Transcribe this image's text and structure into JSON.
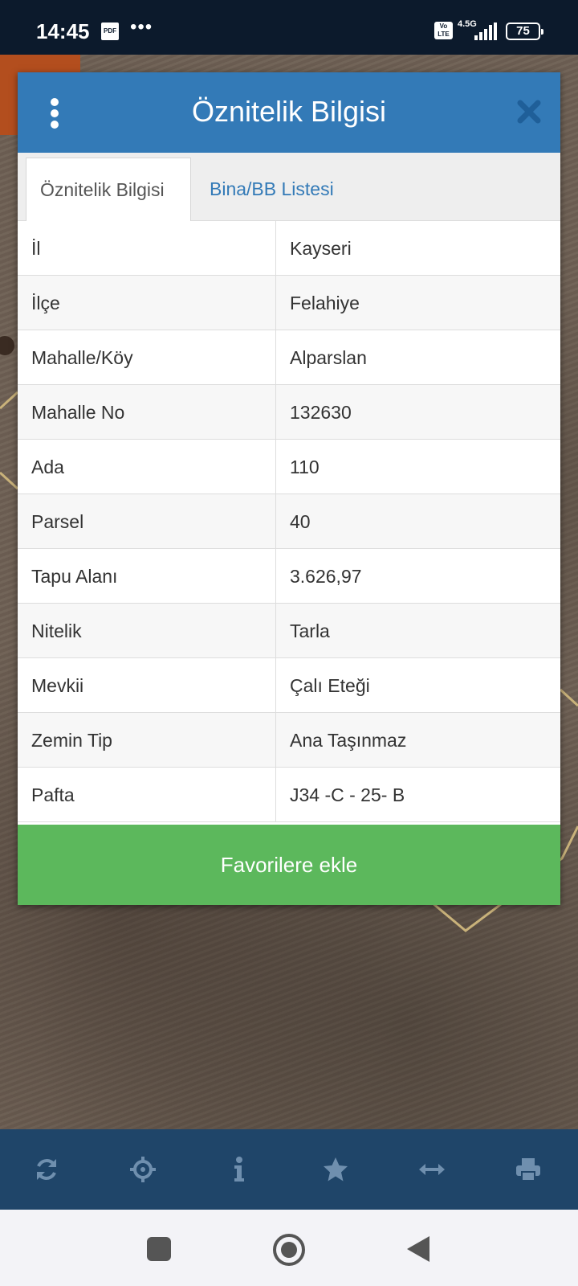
{
  "status_bar": {
    "time": "14:45",
    "pdf_label": "PDF",
    "overflow": "•••",
    "volte": "Vo LTE",
    "network": "4.5G",
    "battery": "75"
  },
  "dialog": {
    "title": "Öznitelik Bilgisi",
    "tabs": [
      {
        "label": "Öznitelik Bilgisi",
        "active": true
      },
      {
        "label": "Bina/BB Listesi",
        "active": false
      }
    ],
    "rows": [
      {
        "label": "İl",
        "value": "Kayseri"
      },
      {
        "label": "İlçe",
        "value": "Felahiye"
      },
      {
        "label": "Mahalle/Köy",
        "value": "Alparslan"
      },
      {
        "label": "Mahalle No",
        "value": "132630"
      },
      {
        "label": "Ada",
        "value": "110"
      },
      {
        "label": "Parsel",
        "value": "40"
      },
      {
        "label": "Tapu Alanı",
        "value": "3.626,97"
      },
      {
        "label": "Nitelik",
        "value": "Tarla"
      },
      {
        "label": "Mevkii",
        "value": "Çalı Eteği"
      },
      {
        "label": "Zemin Tip",
        "value": "Ana Taşınmaz"
      },
      {
        "label": "Pafta",
        "value": "J34 -C - 25- B"
      }
    ],
    "favorite_button": "Favorilere ekle"
  },
  "toolbar": {
    "icons": [
      "refresh-icon",
      "locate-icon",
      "info-icon",
      "star-icon",
      "measure-icon",
      "print-icon"
    ]
  },
  "colors": {
    "header_blue": "#337ab7",
    "button_green": "#5cb85c",
    "toolbar_blue": "#1f4569",
    "tab_link": "#337ab7"
  }
}
